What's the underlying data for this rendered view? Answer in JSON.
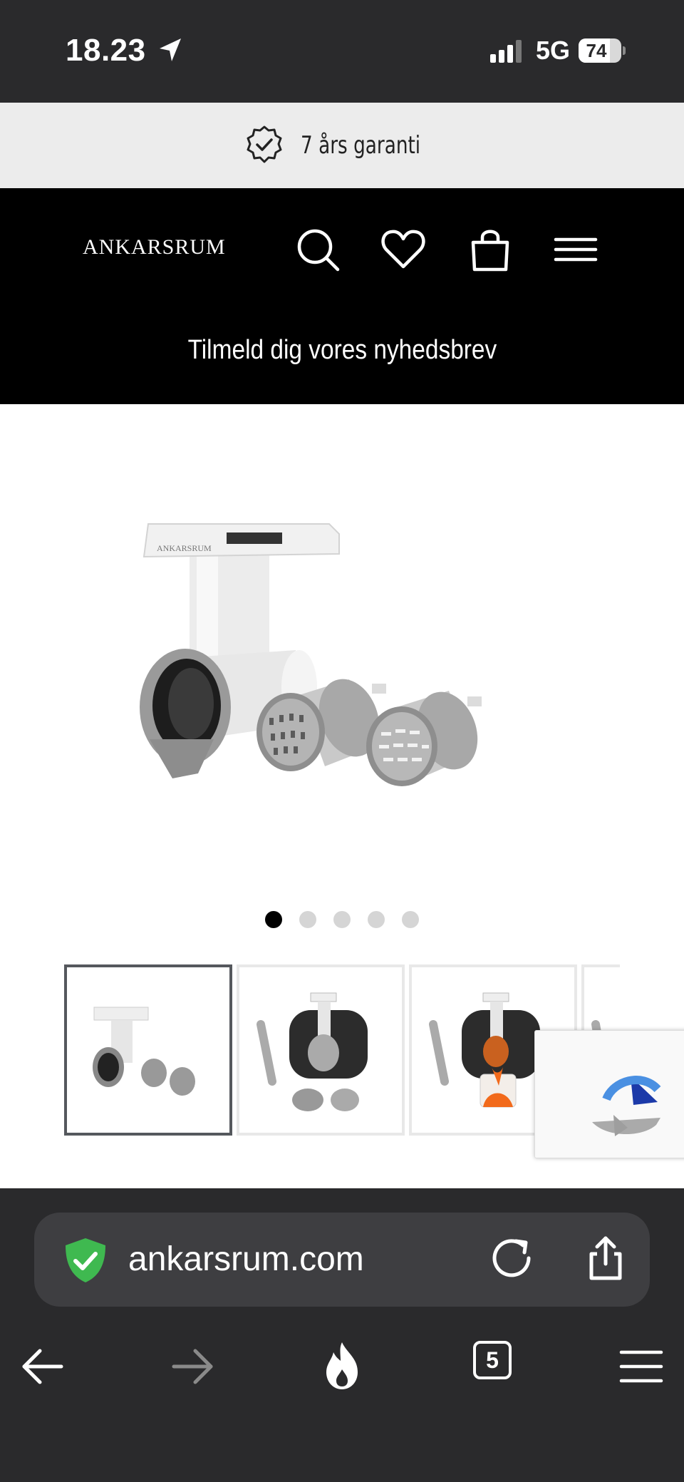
{
  "status_bar": {
    "time": "18.23",
    "network": "5G",
    "battery": "74",
    "battery_level": 0.74
  },
  "promo": {
    "guarantee_text": "7 års garanti"
  },
  "header": {
    "logo": "ANKARSRUM",
    "icons": [
      "search-icon",
      "heart-icon",
      "bag-icon",
      "menu-icon"
    ],
    "newsletter": "Tilmeld dig vores nyhedsbrev"
  },
  "product": {
    "image_brand_text": "ANKARSRUM",
    "carousel": {
      "total": 5,
      "active": 1
    },
    "thumbnails": [
      "Grater with drums",
      "Grater on mixer with drums",
      "Grater on mixer with carrot",
      "Mixer with grater"
    ]
  },
  "browser": {
    "url": "ankarsrum.com",
    "tab_count": "5",
    "icons": [
      "secure-shield-icon",
      "reload-icon",
      "share-icon",
      "back-icon",
      "forward-icon",
      "fire-icon",
      "tabs-icon",
      "menu-icon"
    ]
  },
  "colors": {
    "chrome_bg": "#2a2a2c",
    "header_bg": "#000000",
    "promo_bg": "#ececec",
    "secure_green": "#3fb950"
  }
}
